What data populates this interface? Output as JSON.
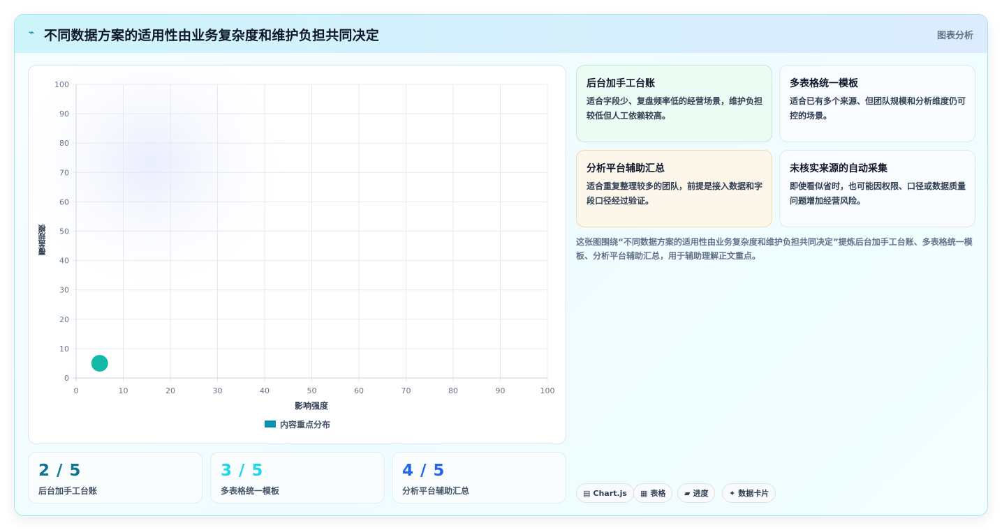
{
  "header": {
    "title": "不同数据方案的适用性由业务复杂度和维护负担共同决定",
    "tag": "图表分析"
  },
  "chart_data": {
    "type": "bubble",
    "xlabel": "影响强度",
    "ylabel": "覆盖规模",
    "xlim": [
      0,
      100
    ],
    "ylim": [
      0,
      100
    ],
    "x_ticks": [
      "0",
      "10",
      "20",
      "30",
      "40",
      "50",
      "60",
      "70",
      "80",
      "90",
      "100"
    ],
    "y_ticks": [
      "0",
      "10",
      "20",
      "30",
      "40",
      "50",
      "60",
      "70",
      "80",
      "90",
      "100"
    ],
    "grid": true,
    "legend_position": "bottom",
    "series": [
      {
        "name": "内容重点分布",
        "color": "#0891b2",
        "points": [
          {
            "x": 5,
            "y": 5,
            "r": 12,
            "color": "#14b8a6"
          }
        ]
      }
    ]
  },
  "stats": [
    {
      "value": "2 / 5",
      "label": "后台加手工台账",
      "color": "#0e7490"
    },
    {
      "value": "3 / 5",
      "label": "多表格统一模板",
      "color": "#22d3ee"
    },
    {
      "value": "4 / 5",
      "label": "分析平台辅助汇总",
      "color": "#2563eb"
    }
  ],
  "cards": [
    {
      "title": "后台加手工台账",
      "desc": "适合字段少、复盘频率低的经营场景，维护负担较低但人工依赖较高。"
    },
    {
      "title": "多表格统一模板",
      "desc": "适合已有多个来源、但团队规模和分析维度仍可控的场景。"
    },
    {
      "title": "分析平台辅助汇总",
      "desc": "适合重复整理较多的团队，前提是接入数据和字段口径经过验证。"
    },
    {
      "title": "未核实来源的自动采集",
      "desc": "即使看似省时，也可能因权限、口径或数据质量问题增加经营风险。"
    }
  ],
  "summary": "这张图围绕“不同数据方案的适用性由业务复杂度和维护负担共同决定”提炼后台加手工台账、多表格统一模板、分析平台辅助汇总，用于辅助理解正文重点。",
  "chips": [
    {
      "icon": "▤",
      "label": "Chart.js"
    },
    {
      "icon": "▦",
      "label": "表格"
    },
    {
      "icon": "▰",
      "label": "进度"
    },
    {
      "icon": "✦",
      "label": "数据卡片"
    }
  ]
}
